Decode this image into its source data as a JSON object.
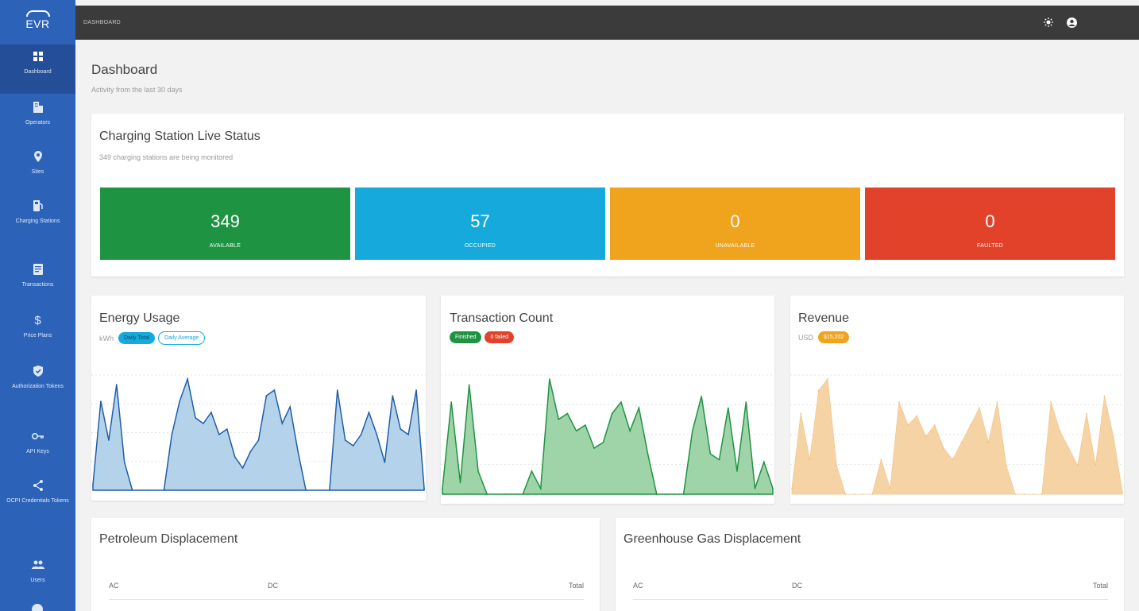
{
  "brand": {
    "logo_text": "EVR"
  },
  "sidebar": {
    "items": [
      {
        "label": "Dashboard",
        "icon": "dashboard-icon",
        "active": true
      },
      {
        "label": "Operators",
        "icon": "building-icon"
      },
      {
        "label": "Sites",
        "icon": "map-pin-icon"
      },
      {
        "label": "Charging Stations",
        "icon": "charging-station-icon"
      },
      {
        "label": "Transactions",
        "icon": "receipt-icon"
      },
      {
        "label": "Price Plans",
        "icon": "dollar-icon"
      },
      {
        "label": "Authorization Tokens",
        "icon": "shield-icon"
      },
      {
        "label": "API Keys",
        "icon": "key-icon"
      },
      {
        "label": "OCPI Credentials Tokens",
        "icon": "share-icon"
      },
      {
        "label": "Users",
        "icon": "users-icon"
      }
    ]
  },
  "topbar": {
    "breadcrumb": "DASHBOARD"
  },
  "header": {
    "title": "Dashboard",
    "subtitle": "Activity from the last 30 days"
  },
  "live_status": {
    "title": "Charging Station Live Status",
    "subtitle": "349 charging stations are being monitored",
    "tiles": [
      {
        "value": "349",
        "label": "AVAILABLE",
        "color": "#1e9443"
      },
      {
        "value": "57",
        "label": "OCCUPIED",
        "color": "#16aadc"
      },
      {
        "value": "0",
        "label": "UNAVAILABLE",
        "color": "#f0a31d"
      },
      {
        "value": "0",
        "label": "FAULTED",
        "color": "#e2412a"
      }
    ]
  },
  "energy": {
    "title": "Energy Usage",
    "unit": "kWh",
    "badge_total": "Daily Total",
    "badge_avg": "Daily Average"
  },
  "transactions": {
    "title": "Transaction Count",
    "badge_finished": "Finished",
    "badge_failed": "0 failed"
  },
  "revenue": {
    "title": "Revenue",
    "unit": "USD",
    "badge_total": "$15,202"
  },
  "petroleum": {
    "title": "Petroleum Displacement",
    "col_ac": "AC",
    "col_dc": "DC",
    "col_total": "Total"
  },
  "greenhouse": {
    "title": "Greenhouse Gas Displacement",
    "col_ac": "AC",
    "col_dc": "DC",
    "col_total": "Total"
  },
  "chart_data": [
    {
      "type": "area",
      "title": "Energy Usage",
      "ylabel": "kWh",
      "series": [
        {
          "name": "Daily Total",
          "values": [
            0.05,
            0.8,
            0.45,
            0.95,
            0.25,
            0,
            0,
            0,
            0,
            0,
            0.5,
            0.8,
            1.0,
            0.65,
            0.6,
            0.7,
            0.5,
            0.55,
            0.3,
            0.2,
            0.35,
            0.45,
            0.85,
            0.9,
            0.6,
            0.75,
            0.35,
            0,
            0,
            0,
            0,
            0.9,
            0.45,
            0.4,
            0.5,
            0.7,
            0.5,
            0.25,
            0.85,
            0.55,
            0.5,
            0.9,
            0.02
          ]
        }
      ],
      "color": "#1f5ea8"
    },
    {
      "type": "area",
      "title": "Transaction Count",
      "series": [
        {
          "name": "Finished",
          "values": [
            0.05,
            0.8,
            0.1,
            0.95,
            0.2,
            0,
            0,
            0,
            0,
            0,
            0.2,
            0.05,
            1.0,
            0.65,
            0.7,
            0.55,
            0.6,
            0.4,
            0.45,
            0.7,
            0.8,
            0.55,
            0.75,
            0.35,
            0,
            0,
            0,
            0,
            0.55,
            0.85,
            0.35,
            0.3,
            0.75,
            0.2,
            0.8,
            0.05,
            0.28,
            0.05
          ]
        }
      ],
      "color": "#1e9443"
    },
    {
      "type": "area",
      "title": "Revenue",
      "ylabel": "USD",
      "series": [
        {
          "name": "$15,202",
          "values": [
            0.05,
            0.7,
            0.3,
            0.9,
            1.0,
            0.25,
            0,
            0,
            0,
            0,
            0.3,
            0.05,
            0.8,
            0.6,
            0.68,
            0.5,
            0.6,
            0.4,
            0.3,
            0.45,
            0.6,
            0.75,
            0.45,
            0.8,
            0.25,
            0,
            0,
            0,
            0,
            0.8,
            0.55,
            0.4,
            0.25,
            0.7,
            0.25,
            0.85,
            0.5,
            0.02
          ]
        }
      ],
      "color": "#f0b36b"
    }
  ]
}
